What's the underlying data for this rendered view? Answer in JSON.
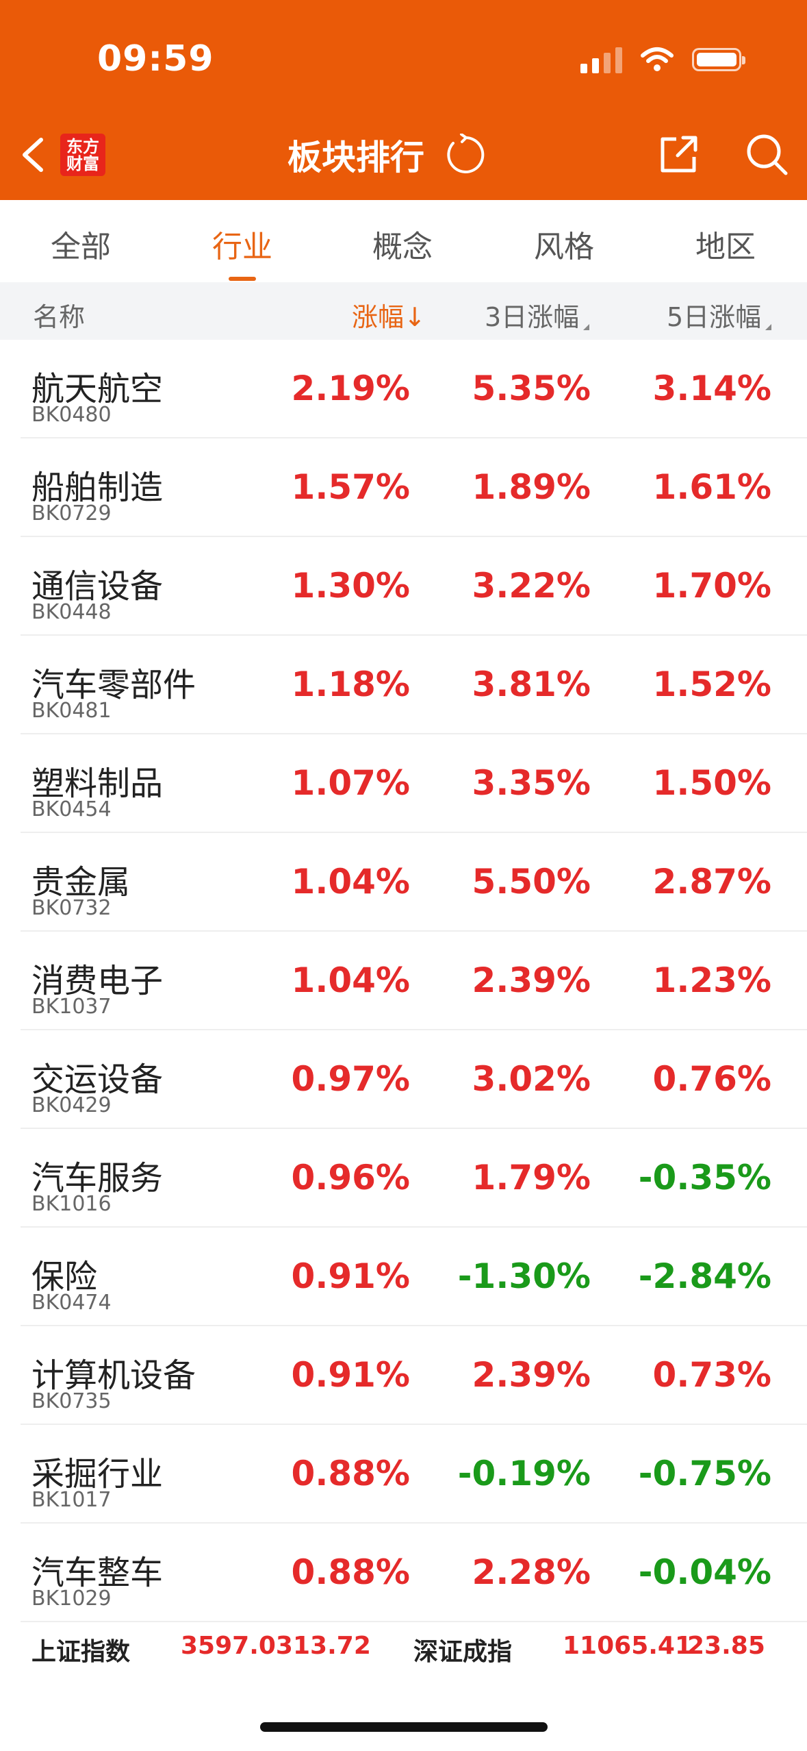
{
  "status": {
    "time": "09:59"
  },
  "header": {
    "logo_line1": "东方",
    "logo_line2": "财富",
    "title": "板块排行"
  },
  "tabs": [
    {
      "label": "全部"
    },
    {
      "label": "行业",
      "active": true
    },
    {
      "label": "概念"
    },
    {
      "label": "风格"
    },
    {
      "label": "地区"
    }
  ],
  "columns": {
    "name": "名称",
    "change": "涨幅↓",
    "change_3d": "3日涨幅",
    "change_5d": "5日涨幅"
  },
  "rows": [
    {
      "name": "航天航空",
      "code": "BK0480",
      "chg": "2.19%",
      "chg3": "5.35%",
      "chg5": "3.14%"
    },
    {
      "name": "船舶制造",
      "code": "BK0729",
      "chg": "1.57%",
      "chg3": "1.89%",
      "chg5": "1.61%"
    },
    {
      "name": "通信设备",
      "code": "BK0448",
      "chg": "1.30%",
      "chg3": "3.22%",
      "chg5": "1.70%"
    },
    {
      "name": "汽车零部件",
      "code": "BK0481",
      "chg": "1.18%",
      "chg3": "3.81%",
      "chg5": "1.52%"
    },
    {
      "name": "塑料制品",
      "code": "BK0454",
      "chg": "1.07%",
      "chg3": "3.35%",
      "chg5": "1.50%"
    },
    {
      "name": "贵金属",
      "code": "BK0732",
      "chg": "1.04%",
      "chg3": "5.50%",
      "chg5": "2.87%"
    },
    {
      "name": "消费电子",
      "code": "BK1037",
      "chg": "1.04%",
      "chg3": "2.39%",
      "chg5": "1.23%"
    },
    {
      "name": "交运设备",
      "code": "BK0429",
      "chg": "0.97%",
      "chg3": "3.02%",
      "chg5": "0.76%"
    },
    {
      "name": "汽车服务",
      "code": "BK1016",
      "chg": "0.96%",
      "chg3": "1.79%",
      "chg5": "-0.35%"
    },
    {
      "name": "保险",
      "code": "BK0474",
      "chg": "0.91%",
      "chg3": "-1.30%",
      "chg5": "-2.84%"
    },
    {
      "name": "计算机设备",
      "code": "BK0735",
      "chg": "0.91%",
      "chg3": "2.39%",
      "chg5": "0.73%"
    },
    {
      "name": "采掘行业",
      "code": "BK1017",
      "chg": "0.88%",
      "chg3": "-0.19%",
      "chg5": "-0.75%"
    },
    {
      "name": "汽车整车",
      "code": "BK1029",
      "chg": "0.88%",
      "chg3": "2.28%",
      "chg5": "-0.04%"
    }
  ],
  "indices": [
    {
      "name": "上证指数",
      "value": "3597.03",
      "change": "13.72"
    },
    {
      "name": "深证成指",
      "value": "11065.41",
      "change": "23.85"
    }
  ],
  "colors": {
    "brand": "#ea5a08",
    "up": "#e52a2a",
    "down": "#1a9a1a",
    "accent": "#e86514"
  }
}
